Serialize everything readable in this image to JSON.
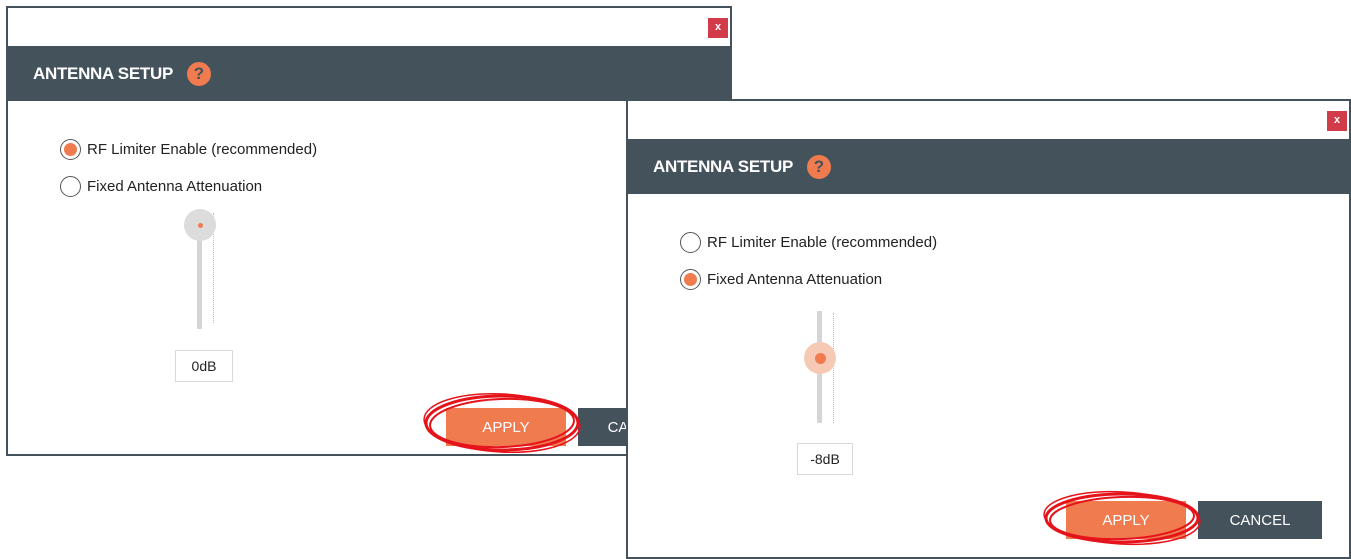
{
  "colors": {
    "header": "#44525c",
    "accent": "#ef7b4f",
    "close": "#d23b49",
    "annotation": "#e5141b"
  },
  "dialogs": [
    {
      "close_label": "x",
      "title": "ANTENNA SETUP",
      "help_label": "?",
      "options": [
        {
          "label": "RF Limiter Enable (recommended)",
          "selected": true
        },
        {
          "label": "Fixed Antenna Attenuation",
          "selected": false
        }
      ],
      "slider_value": "0dB",
      "apply_label": "APPLY",
      "cancel_label": "CANCEL"
    },
    {
      "close_label": "x",
      "title": "ANTENNA SETUP",
      "help_label": "?",
      "options": [
        {
          "label": "RF Limiter Enable (recommended)",
          "selected": false
        },
        {
          "label": "Fixed Antenna Attenuation",
          "selected": true
        }
      ],
      "slider_value": "-8dB",
      "apply_label": "APPLY",
      "cancel_label": "CANCEL"
    }
  ]
}
